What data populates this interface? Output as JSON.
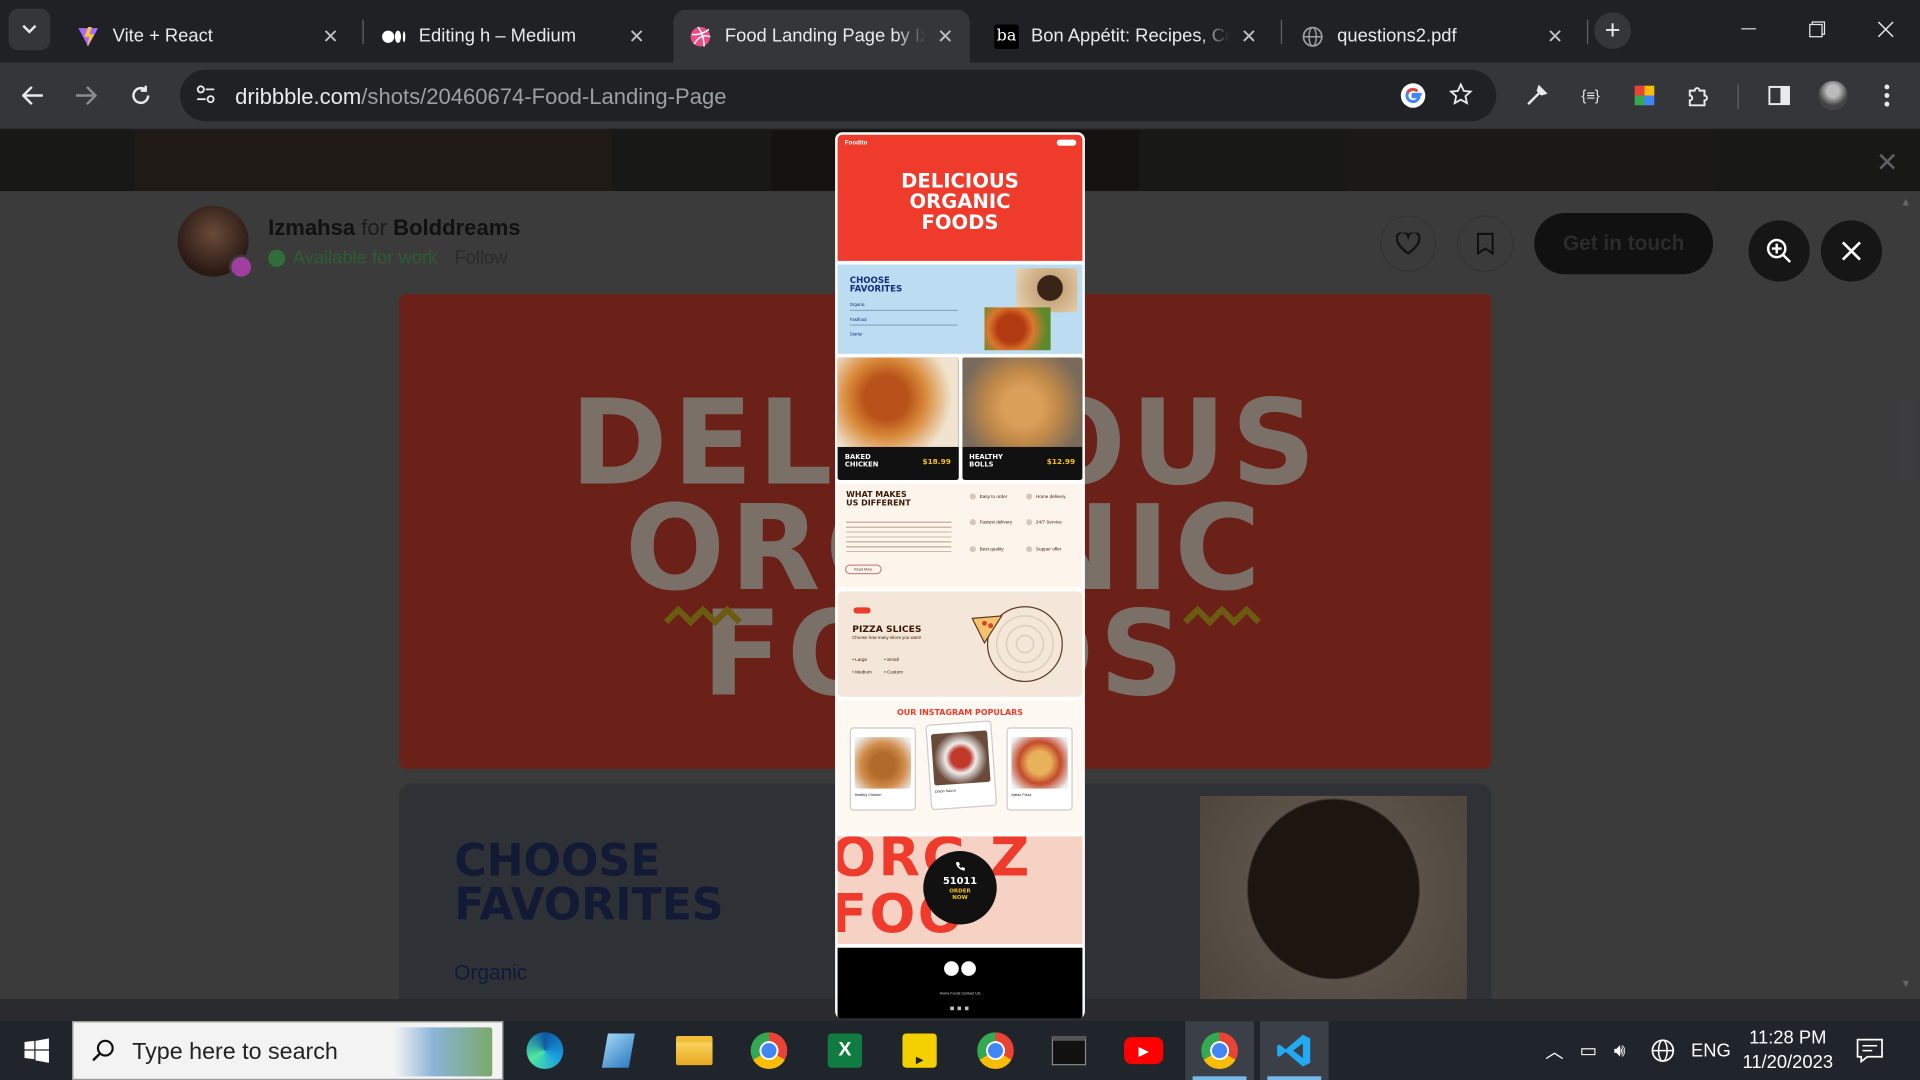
{
  "browser": {
    "tabs": [
      {
        "title": "Vite + React",
        "icon": "vite-icon"
      },
      {
        "title": "Editing h – Medium",
        "icon": "medium-icon"
      },
      {
        "title": "Food Landing Page by Iz",
        "icon": "dribbble-icon",
        "active": true
      },
      {
        "title": "Bon Appétit: Recipes, Co",
        "icon": "bon-appetit-icon"
      },
      {
        "title": "questions2.pdf",
        "icon": "globe-icon"
      }
    ],
    "url_domain": "dribbble.com",
    "url_path": "/shots/20460674-Food-Landing-Page"
  },
  "shot": {
    "author": "Izmahsa",
    "for_word": "for",
    "team": "Bolddreams",
    "availability": "Available for work",
    "follow": "Follow",
    "get_in_touch": "Get in touch",
    "hero_lines": [
      "DELICIOUS",
      "ORGANIC",
      "FOODS"
    ],
    "choose_title_1": "CHOOSE",
    "choose_title_2": "FAVORITES",
    "choose_item": "Organic"
  },
  "preview": {
    "logo": "Foodito",
    "hero_lines": [
      "DELICIOUS",
      "ORGANIC",
      "FOODS"
    ],
    "choose_title_1": "CHOOSE",
    "choose_title_2": "FAVORITES",
    "choose_items": [
      "Organic",
      "Fastfood",
      "Starter"
    ],
    "cards": [
      {
        "name_1": "BAKED",
        "name_2": "CHICKEN",
        "price": "$18.99"
      },
      {
        "name_1": "HEALTHY",
        "name_2": "BOLLS",
        "price": "$12.99"
      }
    ],
    "different_title_1": "WHAT MAKES",
    "different_title_2": "US DIFFERENT",
    "read_more": "Read More",
    "features": [
      "Easy to order",
      "Home delivery",
      "Fastest delivery",
      "24/7 Service",
      "Best quality",
      "Supper offer"
    ],
    "pizza_title": "PIZZA SLICES",
    "pizza_sub": "Choose how many slices you want!",
    "pizza_options": [
      "Large",
      "Small",
      "Medium",
      "Custom"
    ],
    "instagram_title": "OUR INSTAGRAM POPULARS",
    "instagram_items": [
      "Healthy Chicken",
      "Onion Sauce",
      "Italian Pizza"
    ],
    "order_number": "51011",
    "order_cta_1": "ORDER",
    "order_cta_2": "NOW",
    "order_bg_1": "ORG Z",
    "order_bg_2": "FOO",
    "footer_links": "Home   Foods   Contact US"
  },
  "taskbar": {
    "search_placeholder": "Type here to search",
    "language": "ENG",
    "time": "11:28 PM",
    "date": "11/20/2023"
  },
  "colors": {
    "accent_red": "#ef3b2c",
    "dark_bg": "#202124",
    "toolbar_bg": "#35363a",
    "taskbar_bg": "#20252c"
  }
}
